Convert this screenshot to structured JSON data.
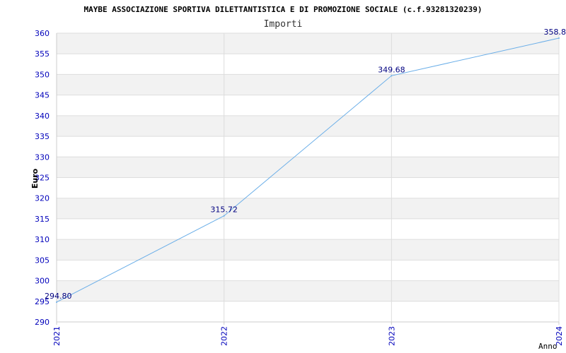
{
  "chart_data": {
    "type": "line",
    "title": "MAYBE ASSOCIAZIONE SPORTIVA DILETTANTISTICA E DI PROMOZIONE SOCIALE (c.f.93281320239)",
    "subtitle": "Importi",
    "xlabel": "Anno",
    "ylabel": "Euro",
    "categories": [
      "2021",
      "2022",
      "2023",
      "2024"
    ],
    "series": [
      {
        "values": [
          294.8,
          315.72,
          349.68,
          358.8
        ],
        "labels": [
          "294.80",
          "315.72",
          "349.68",
          "358.8"
        ]
      }
    ],
    "ylim": [
      290,
      360
    ],
    "yticks": [
      290,
      295,
      300,
      305,
      310,
      315,
      320,
      325,
      330,
      335,
      340,
      345,
      350,
      355,
      360
    ],
    "grid": true,
    "colors": {
      "line": "#6aaee8",
      "band": "#f2f2f2",
      "grid": "#dddddd",
      "axis": "#cccccc",
      "tick_text": "#0000bb",
      "label_text": "#000080",
      "title_text": "#000000",
      "subtitle_text": "#333333"
    }
  }
}
